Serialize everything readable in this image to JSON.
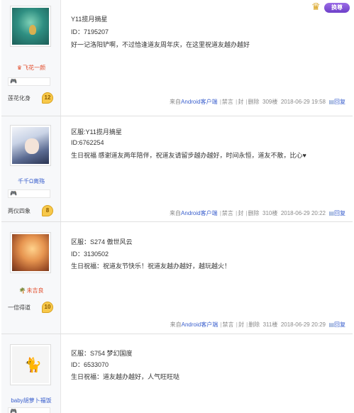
{
  "swap_button": {
    "label": "换尊"
  },
  "floors": [
    {
      "user": {
        "name": "飞花一颜",
        "level_title": "莲花化身",
        "level": "12"
      },
      "lines": [
        "Y11揽月摘星",
        "ID：7195207",
        "好一记洛阳铲啊，不过恰逢道友周年庆，在这里祝道友越办越好"
      ],
      "footer": {
        "source_prefix": "来自",
        "source_link": "Android客户端",
        "report": "禁言",
        "block": "封",
        "delete": "删除",
        "floor": "309楼",
        "time": "2018-06-29 19:58",
        "reply": "回复"
      }
    },
    {
      "user": {
        "name": "千千Ω离殇",
        "level_title": "两仪四象",
        "level": "8"
      },
      "lines": [
        "区服:Y11揽月摘星",
        "ID:6762254",
        "生日祝福 感谢道友两年陪伴，祝道友请留步越办越好，时间永恒，道友不散，比心♥"
      ],
      "footer": {
        "source_prefix": "来自",
        "source_link": "Android客户端",
        "report": "禁言",
        "block": "封",
        "delete": "删除",
        "floor": "310楼",
        "time": "2018-06-29 20:22",
        "reply": "回复"
      }
    },
    {
      "user": {
        "name": "未吉良",
        "level_title": "一倍得道",
        "level": "10"
      },
      "lines": [
        "区服：S274 傲世风云",
        "ID：3130502",
        "生日祝福：祝道友节快乐！祝道友越办越好，越玩越火！"
      ],
      "footer": {
        "source_prefix": "来自",
        "source_link": "Android客户端",
        "report": "禁言",
        "block": "封",
        "delete": "删除",
        "floor": "311楼",
        "time": "2018-06-29 20:29",
        "reply": "回复"
      }
    },
    {
      "user": {
        "name": "baby胡萝卜福饭"
      },
      "lines": [
        "区服：S754 梦幻国度",
        "ID：6533070",
        "生日祝福：道友越办越好，人气旺旺哒"
      ]
    }
  ]
}
